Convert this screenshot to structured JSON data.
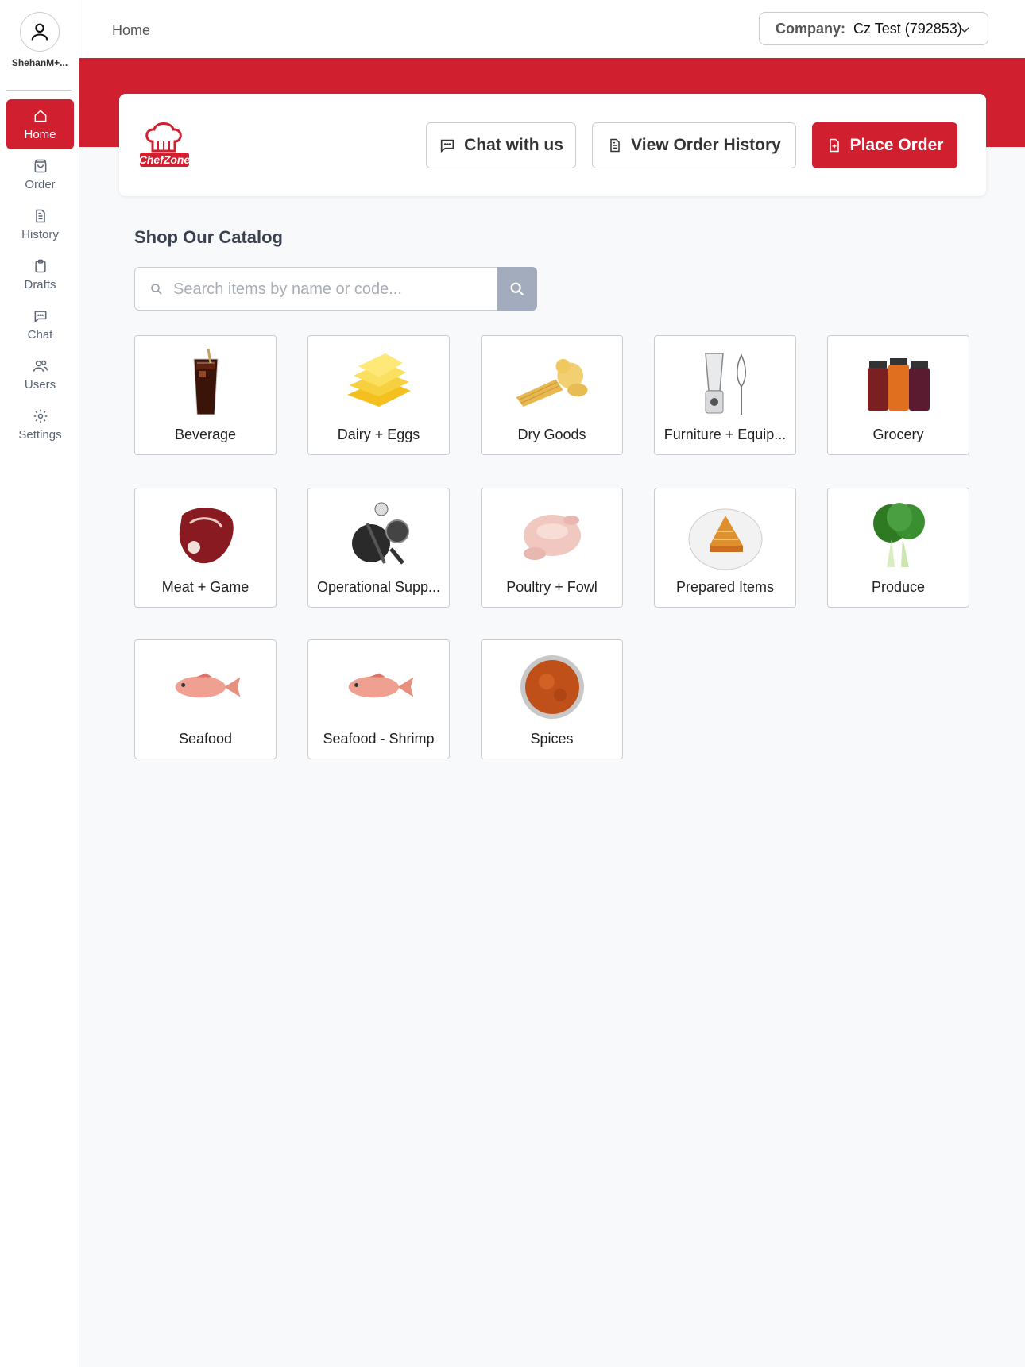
{
  "user": {
    "name": "ShehanM+..."
  },
  "nav": [
    {
      "label": "Home",
      "icon": "home-icon"
    },
    {
      "label": "Order",
      "icon": "bag-icon"
    },
    {
      "label": "History",
      "icon": "document-icon"
    },
    {
      "label": "Drafts",
      "icon": "clipboard-icon"
    },
    {
      "label": "Chat",
      "icon": "chat-icon"
    },
    {
      "label": "Users",
      "icon": "users-icon"
    },
    {
      "label": "Settings",
      "icon": "gear-icon"
    }
  ],
  "breadcrumb": "Home",
  "company": {
    "label": "Company:",
    "value": "Cz Test (792853)"
  },
  "header": {
    "logo_text": "ChefZone",
    "chat_label": "Chat with us",
    "history_label": "View Order History",
    "order_label": "Place Order"
  },
  "catalog": {
    "title": "Shop Our Catalog",
    "search_placeholder": "Search items by name or code...",
    "categories": [
      {
        "label": "Beverage",
        "icon": "beverage-icon"
      },
      {
        "label": "Dairy + Eggs",
        "icon": "cheese-icon"
      },
      {
        "label": "Dry Goods",
        "icon": "pasta-icon"
      },
      {
        "label": "Furniture + Equip...",
        "icon": "blender-icon"
      },
      {
        "label": "Grocery",
        "icon": "jars-icon"
      },
      {
        "label": "Meat + Game",
        "icon": "steak-icon"
      },
      {
        "label": "Operational Supp...",
        "icon": "cookware-icon"
      },
      {
        "label": "Poultry + Fowl",
        "icon": "chicken-icon"
      },
      {
        "label": "Prepared Items",
        "icon": "pie-icon"
      },
      {
        "label": "Produce",
        "icon": "bok-choy-icon"
      },
      {
        "label": "Seafood",
        "icon": "fish-icon"
      },
      {
        "label": "Seafood - Shrimp",
        "icon": "fish-icon"
      },
      {
        "label": "Spices",
        "icon": "spice-bowl-icon"
      }
    ]
  },
  "colors": {
    "brand_red": "#d02030",
    "search_button": "#a3acbd"
  }
}
